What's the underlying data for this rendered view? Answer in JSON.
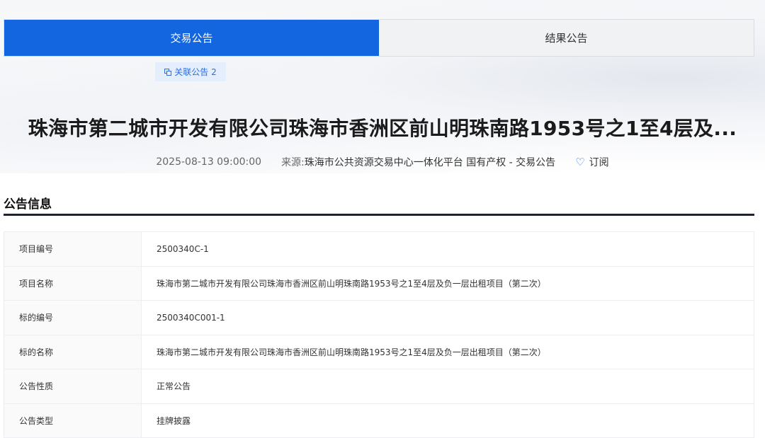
{
  "tabs": [
    {
      "label": "交易公告",
      "active": true
    },
    {
      "label": "结果公告",
      "active": false
    }
  ],
  "related": {
    "label": "关联公告 2",
    "icon": "copy-icon"
  },
  "header": {
    "title": "珠海市第二城市开发有限公司珠海市香洲区前山明珠南路1953号之1至4层及...",
    "date": "2025-08-13 09:00:00",
    "source_label": "来源:",
    "source": "珠海市公共资源交易中心一体化平台 国有产权 - 交易公告",
    "subscribe_label": "订阅",
    "subscribe_icon": "heart-icon"
  },
  "section": {
    "title": "公告信息"
  },
  "info_rows": [
    {
      "label": "项目编号",
      "value": "2500340C-1"
    },
    {
      "label": "项目名称",
      "value": "珠海市第二城市开发有限公司珠海市香洲区前山明珠南路1953号之1至4层及负一层出租项目（第二次）"
    },
    {
      "label": "标的编号",
      "value": "2500340C001-1"
    },
    {
      "label": "标的名称",
      "value": "珠海市第二城市开发有限公司珠海市香洲区前山明珠南路1953号之1至4层及负一层出租项目（第二次）"
    },
    {
      "label": "公告性质",
      "value": "正常公告"
    },
    {
      "label": "公告类型",
      "value": "挂牌披露"
    }
  ],
  "colors": {
    "accent": "#1466e0",
    "link": "#2b6fe0",
    "section_line": "#1d2430"
  }
}
